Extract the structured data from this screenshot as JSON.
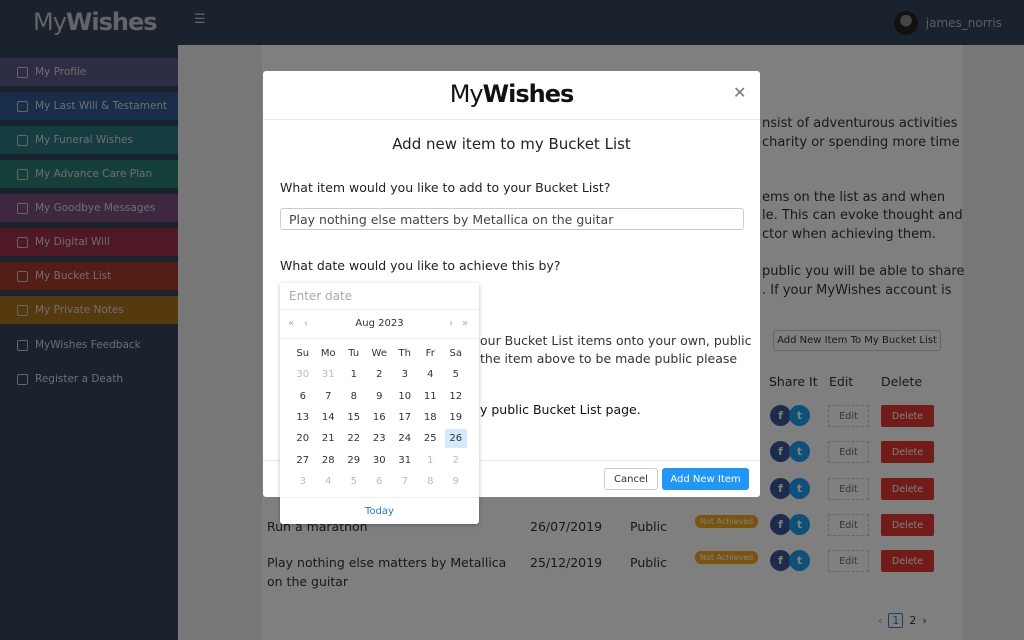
{
  "app": {
    "logo_light": "My",
    "logo_bold": "Wishes",
    "username": "james_norris"
  },
  "sidebar": {
    "items": [
      {
        "label": "My Profile",
        "icon": "user-circle-icon",
        "color": "#5b5a8c"
      },
      {
        "label": "My Last Will & Testament",
        "icon": "scroll-icon",
        "color": "#305a92"
      },
      {
        "label": "My Funeral Wishes",
        "icon": "headstone-icon",
        "color": "#2a7a82"
      },
      {
        "label": "My Advance Care Plan",
        "icon": "document-icon",
        "color": "#2a8072"
      },
      {
        "label": "My Goodbye Messages",
        "icon": "fingerprint-icon",
        "color": "#7a5080"
      },
      {
        "label": "My Digital Will",
        "icon": "laptop-icon",
        "color": "#9c3048"
      },
      {
        "label": "My Bucket List",
        "icon": "bucket-icon",
        "color": "#a83a2c"
      },
      {
        "label": "My Private Notes",
        "icon": "notes-icon",
        "color": "#aa7420"
      },
      {
        "label": "MyWishes Feedback",
        "icon": "edit-icon",
        "color": ""
      },
      {
        "label": "Register a Death",
        "icon": "register-icon",
        "color": ""
      }
    ]
  },
  "background": {
    "text_fragments": [
      "nsist of adventurous activities",
      "charity or spending more time",
      "ems on the list as and when",
      "le. This can evoke thought and",
      "ctor when achieving them.",
      "public you will be able to share",
      ". If your MyWishes account is"
    ],
    "add_button": "Add New Item To My Bucket List",
    "table": {
      "headers": [
        "Share It",
        "Edit",
        "Delete"
      ],
      "rows": [
        {
          "item": "",
          "date": "",
          "visibility": "",
          "status": "",
          "edit": "Edit",
          "delete": "Delete"
        },
        {
          "item": "",
          "date": "",
          "visibility": "",
          "status": "",
          "edit": "Edit",
          "delete": "Delete"
        },
        {
          "item": "",
          "date": "",
          "visibility": "",
          "status": "",
          "edit": "Edit",
          "delete": "Delete"
        },
        {
          "item": "Run a marathon",
          "date": "26/07/2019",
          "visibility": "Public",
          "status": "Not Achieved",
          "edit": "Edit",
          "delete": "Delete"
        },
        {
          "item": "Play nothing else matters by Metallica on the guitar",
          "date": "25/12/2019",
          "visibility": "Public",
          "status": "Not Achieved",
          "edit": "Edit",
          "delete": "Delete"
        }
      ]
    },
    "pagination": {
      "pages": [
        "1",
        "2"
      ],
      "current": "1"
    }
  },
  "modal": {
    "logo_light": "My",
    "logo_bold": "Wishes",
    "title": "Add new item to my Bucket List",
    "item_label": "What item would you like to add to your Bucket List?",
    "item_value": "Play nothing else matters by Metallica on the guitar",
    "date_label": "What date would you like to achieve this by?",
    "partial_text": [
      "our Bucket List items onto your own, public",
      "the item above to be made public please",
      "y public Bucket List page."
    ],
    "cancel": "Cancel",
    "submit": "Add New Item"
  },
  "datepicker": {
    "placeholder": "Enter date",
    "month": "Aug 2023",
    "selected": "26",
    "weekdays": [
      "Su",
      "Mo",
      "Tu",
      "We",
      "Th",
      "Fr",
      "Sa"
    ],
    "days": [
      "30",
      "31",
      "1",
      "2",
      "3",
      "4",
      "5",
      "6",
      "7",
      "8",
      "9",
      "10",
      "11",
      "12",
      "13",
      "14",
      "15",
      "16",
      "17",
      "18",
      "19",
      "20",
      "21",
      "22",
      "23",
      "24",
      "25",
      "26",
      "27",
      "28",
      "29",
      "30",
      "31",
      "1",
      "2",
      "3",
      "4",
      "5",
      "6",
      "7",
      "8",
      "9"
    ],
    "today": "Today"
  }
}
